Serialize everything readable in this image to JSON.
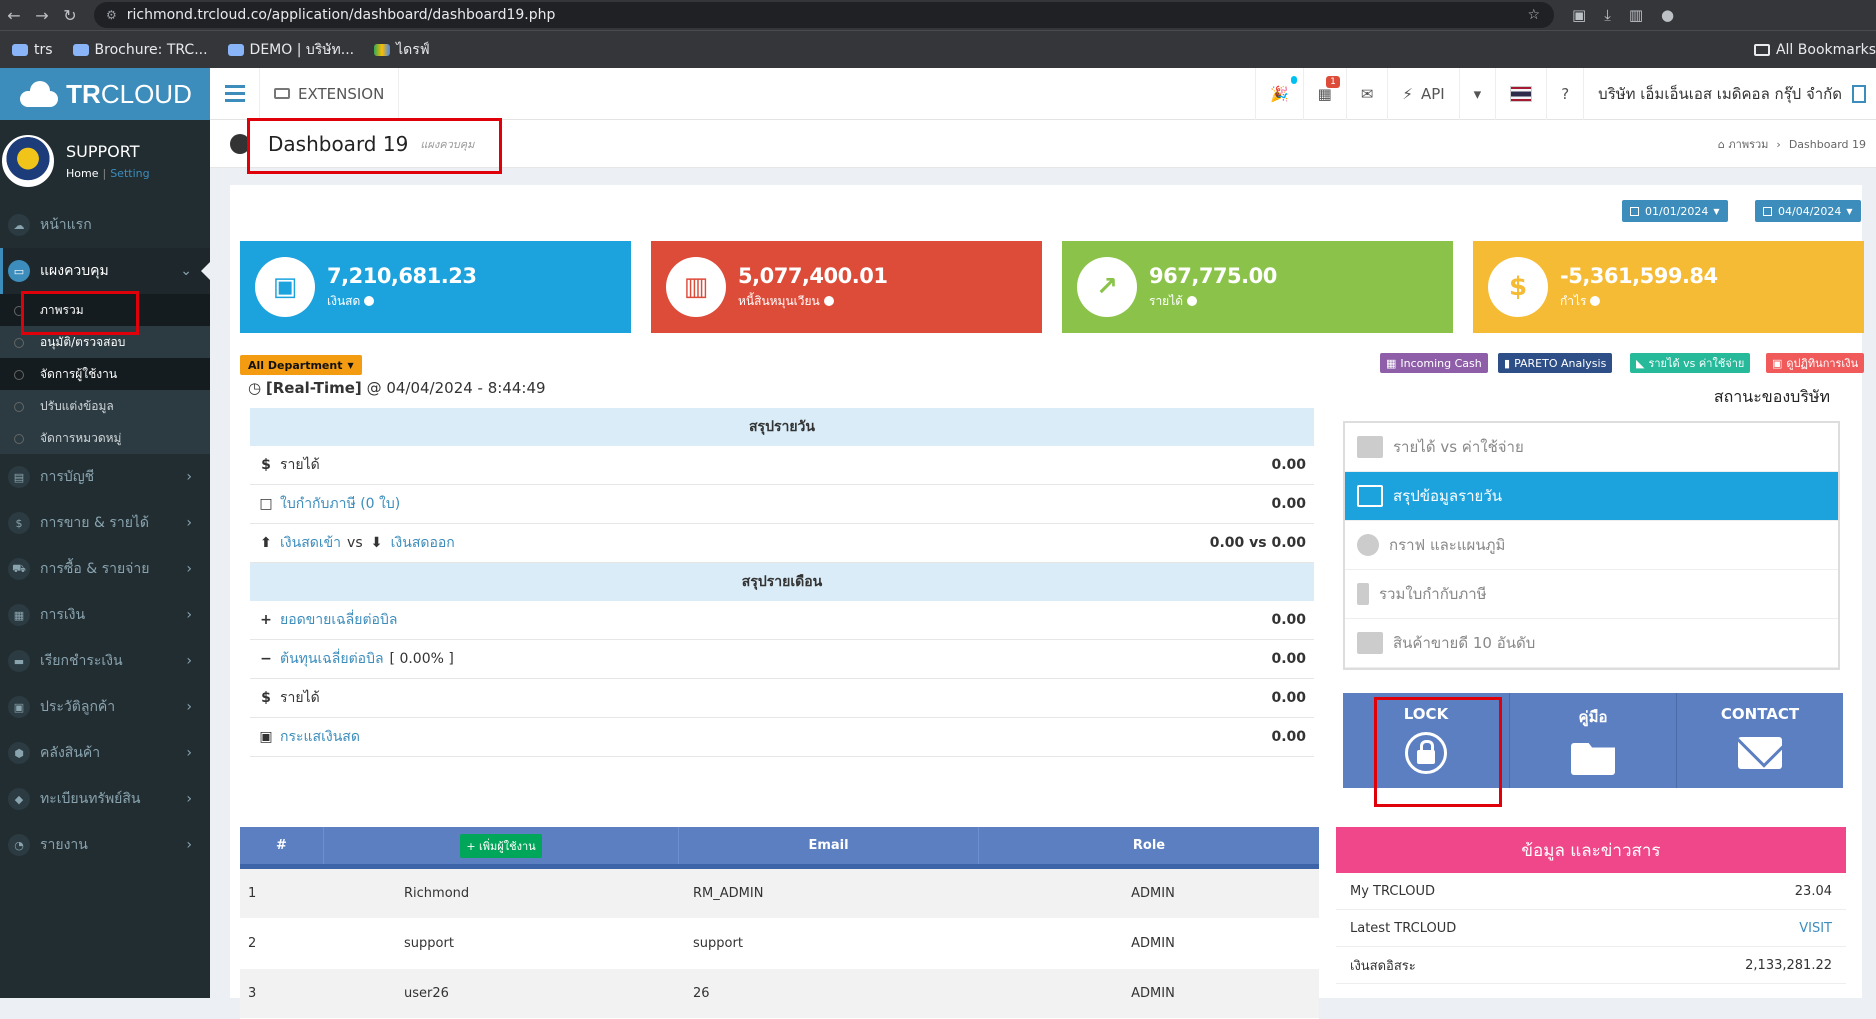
{
  "browser": {
    "url": "richmond.trcloud.co/application/dashboard/dashboard19.php",
    "bookmarks": [
      "trs",
      "Brochure: TRC...",
      "DEMO | บริษัท...",
      "ไดรฟ์"
    ],
    "all_bookmarks": "All Bookmarks"
  },
  "app": {
    "logo_bold": "TR",
    "logo_light": "CLOUD",
    "extension_label": "EXTENSION",
    "api_label": "API",
    "notification_count": "1",
    "company_name": "บริษัท เอ็มเอ็นเอส เมดิคอล กรุ๊ป จำกัด"
  },
  "sidebar": {
    "user_name": "SUPPORT",
    "home_link": "Home",
    "setting_link": "Setting",
    "items": [
      {
        "label": "หน้าแรก",
        "icon": "cloud-icon"
      },
      {
        "label": "แผงควบคุม",
        "icon": "monitor-icon"
      },
      {
        "label": "การบัญชี",
        "icon": "book-icon"
      },
      {
        "label": "การขาย & รายได้",
        "icon": "dollar-icon"
      },
      {
        "label": "การซื้อ & รายจ่าย",
        "icon": "cart-icon"
      },
      {
        "label": "การเงิน",
        "icon": "calendar-icon"
      },
      {
        "label": "เรียกชำระเงิน",
        "icon": "card-icon"
      },
      {
        "label": "ประวัติลูกค้า",
        "icon": "contact-icon"
      },
      {
        "label": "คลังสินค้า",
        "icon": "cubes-icon"
      },
      {
        "label": "ทะเบียนทรัพย์สิน",
        "icon": "diamond-icon"
      },
      {
        "label": "รายงาน",
        "icon": "report-icon"
      }
    ],
    "submenu": [
      "ภาพรวม",
      "อนุมัติ/ตรวจสอบ",
      "จัดการผู้ใช้งาน",
      "ปรับแต่งข้อมูล",
      "จัดการหมวดหมู่"
    ]
  },
  "header": {
    "title": "Dashboard 19",
    "subtitle": "แผงควบคุม",
    "breadcrumb_home": "ภาพรวม",
    "breadcrumb_current": "Dashboard 19"
  },
  "dates": {
    "from": "01/01/2024",
    "to": "04/04/2024"
  },
  "kpis": [
    {
      "value": "7,210,681.23",
      "label": "เงินสด",
      "color": "#1ca3dd",
      "icon": "money-icon"
    },
    {
      "value": "5,077,400.01",
      "label": "หนี้สินหมุนเวียน",
      "color": "#dd4b39",
      "icon": "bank-icon"
    },
    {
      "value": "967,775.00",
      "label": "รายได้",
      "color": "#8bc34a",
      "icon": "chart-icon"
    },
    {
      "value": "-5,361,599.84",
      "label": "กำไร",
      "color": "#f6bb34",
      "icon": "dollar-icon"
    }
  ],
  "department": "All Department",
  "realtime": {
    "label": "[Real-Time]",
    "at": "@ 04/04/2024 - 8:44:49"
  },
  "daily": {
    "title": "สรุปรายวัน",
    "rows": [
      {
        "label": "รายได้",
        "value": "0.00",
        "icon": "$"
      },
      {
        "label": "ใบกำกับภาษี (0 ใบ)",
        "value": "0.00",
        "icon": "□"
      },
      {
        "label_in": "เงินสดเข้า",
        "vs": "vs",
        "label_out": "เงินสดออก",
        "value": "0.00 vs 0.00"
      }
    ]
  },
  "monthly": {
    "title": "สรุปรายเดือน",
    "rows": [
      {
        "label": "ยอดขายเฉลี่ยต่อบิล",
        "value": "0.00",
        "icon": "+"
      },
      {
        "label": "ต้นทุนเฉลี่ยต่อบิล",
        "extra": "[ 0.00% ]",
        "value": "0.00",
        "icon": "−"
      },
      {
        "label": "รายได้",
        "value": "0.00",
        "icon": "$"
      },
      {
        "label": "กระแสเงินสด",
        "value": "0.00",
        "icon": "▣"
      }
    ]
  },
  "report_buttons": [
    {
      "label": "Incoming Cash",
      "color": "#8e5fa8"
    },
    {
      "label": "PARETO Analysis",
      "color": "#2d4e86"
    },
    {
      "label": "รายได้ vs ค่าใช้จ่าย",
      "color": "#26b99a"
    },
    {
      "label": "ดูปฏิทินการเงิน",
      "color": "#f05a5a"
    }
  ],
  "status": {
    "title": "สถานะของบริษัท",
    "items": [
      "รายได้ vs ค่าใช้จ่าย",
      "สรุปข้อมูลรายวัน",
      "กราฟ และแผนภูมิ",
      "รวมใบกำกับภาษี",
      "สินค้าขายดี 10 อันดับ"
    ]
  },
  "tools": [
    {
      "label": "LOCK",
      "icon": "lock-icon"
    },
    {
      "label": "คู่มือ",
      "icon": "folder-open-icon"
    },
    {
      "label": "CONTACT",
      "icon": "envelope-icon"
    }
  ],
  "users": {
    "headers": {
      "num": "#",
      "add": "เพิ่มผู้ใช้งาน",
      "email": "Email",
      "role": "Role"
    },
    "rows": [
      {
        "num": "1",
        "name": "Richmond",
        "email": "RM_ADMIN",
        "role": "ADMIN"
      },
      {
        "num": "2",
        "name": "support",
        "email": "support",
        "role": "ADMIN"
      },
      {
        "num": "3",
        "name": "user26",
        "email": "26",
        "role": "ADMIN"
      }
    ]
  },
  "news": {
    "title": "ข้อมูล และข่าวสาร",
    "rows": [
      {
        "label": "My TRCLOUD",
        "value": "23.04"
      },
      {
        "label": "Latest TRCLOUD",
        "value": "VISIT"
      },
      {
        "label": "เงินสดอิสระ",
        "value": "2,133,281.22"
      }
    ]
  }
}
